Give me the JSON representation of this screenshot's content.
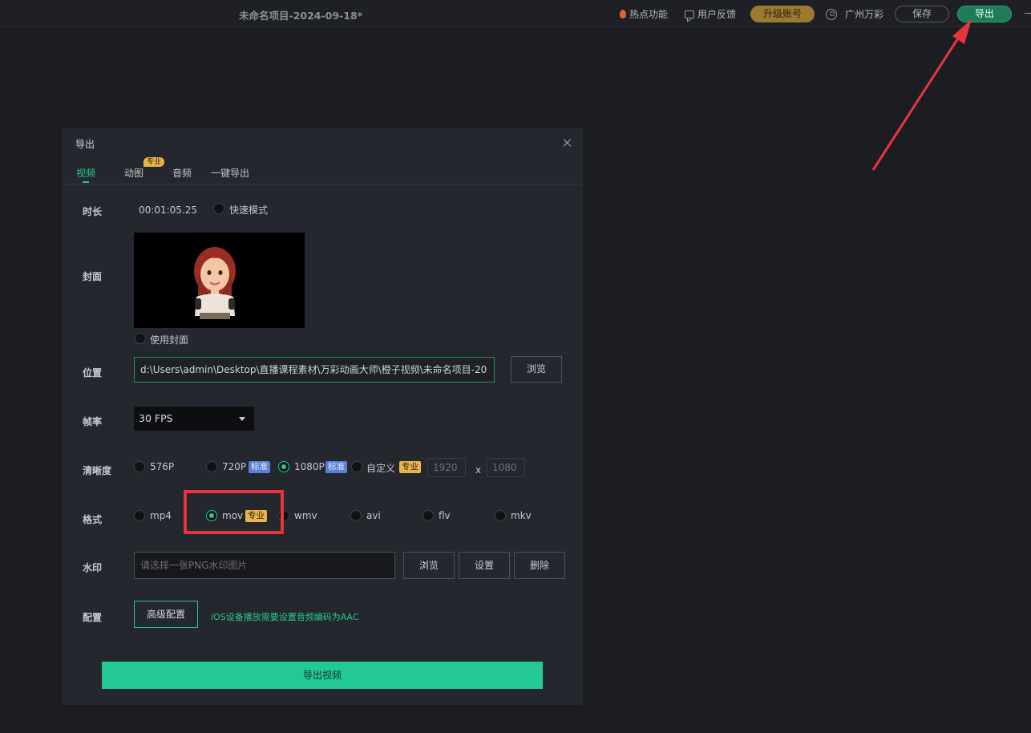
{
  "topbar": {
    "project_title": "未命名项目-2024-09-18*",
    "hot_features": "热点功能",
    "feedback": "用户反馈",
    "upgrade": "升级账号",
    "username": "广州万彩",
    "save": "保存",
    "export": "导出"
  },
  "dialog": {
    "title": "导出",
    "tabs": [
      {
        "label": "视频",
        "active": true
      },
      {
        "label": "动图",
        "badge": "专业"
      },
      {
        "label": "音频"
      },
      {
        "label": "一键导出"
      }
    ],
    "duration": {
      "label": "时长",
      "value": "00:01:05.25",
      "fast_mode": "快速模式"
    },
    "cover": {
      "label": "封面",
      "use_cover": "使用封面"
    },
    "location": {
      "label": "位置",
      "path": "d:\\Users\\admin\\Desktop\\直播课程素材\\万彩动画大师\\橙子视频\\未命名项目-20",
      "browse": "浏览"
    },
    "framerate": {
      "label": "帧率",
      "selected": "30 FPS"
    },
    "resolution": {
      "label": "清晰度",
      "options": [
        "576P",
        "720P",
        "1080P",
        "自定义"
      ],
      "selected": "1080P",
      "badge_std": "标准",
      "badge_pro": "专业",
      "width": "1920",
      "height": "1080",
      "x": "x"
    },
    "format": {
      "label": "格式",
      "options": [
        "mp4",
        "mov",
        "wmv",
        "avi",
        "flv",
        "mkv"
      ],
      "selected": "mov",
      "badge_pro": "专业"
    },
    "watermark": {
      "label": "水印",
      "placeholder": "请选择一张PNG水印图片",
      "browse": "浏览",
      "settings": "设置",
      "delete": "删除"
    },
    "config": {
      "label": "配置",
      "advanced": "高级配置",
      "tip": "iOS设备播放需要设置音频编码为AAC"
    },
    "export_video": "导出视频"
  },
  "colors": {
    "accent_green": "#27c891",
    "upgrade_gold": "#9d7a32",
    "pro_badge": "#e8b54d",
    "std_badge": "#5b7fd8",
    "annotation_red": "#e8343c"
  }
}
